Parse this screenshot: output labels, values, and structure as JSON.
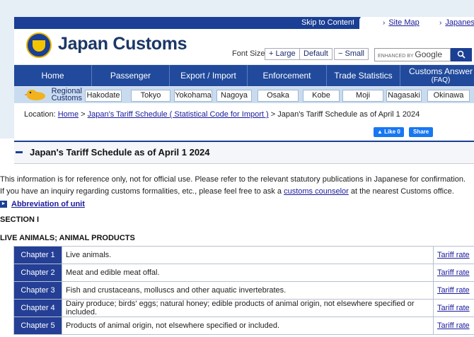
{
  "header": {
    "skip_link": "Skip to Content",
    "top_links": [
      "Site Map",
      "Japanese"
    ],
    "logo_text": "Japan Customs",
    "font_size_label": "Font Size",
    "font_buttons": [
      "+ Large",
      "Default",
      "− Small"
    ],
    "search_enhanced_by": "ENHANCED BY",
    "search_brand": "Google",
    "search_icon": "search-icon"
  },
  "nav": {
    "items": [
      "Home",
      "Passenger",
      "Export / Import",
      "Enforcement",
      "Trade Statistics"
    ],
    "last_item": {
      "line1": "Customs Answer",
      "line2": "(FAQ)"
    }
  },
  "regional": {
    "label_line1": "Regional",
    "label_line2": "Customs",
    "cities": [
      "Hakodate",
      "Tokyo",
      "Yokohama",
      "Nagoya",
      "Osaka",
      "Kobe",
      "Moji",
      "Nagasaki",
      "Okinawa"
    ]
  },
  "breadcrumb": {
    "prefix": "Location:",
    "home": "Home",
    "sep": ">",
    "parent": "Japan's Tariff Schedule ( Statistical Code for Import )",
    "current": "Japan's Tariff Schedule as of April 1 2024"
  },
  "social": {
    "like": "Like 0",
    "share": "Share"
  },
  "page": {
    "title": "Japan's Tariff Schedule as of April 1 2024",
    "notice1": "This information is for reference only, not for official use. Please refer to the relevant statutory publications in Japanese for confirmation.",
    "notice2_before": "If you have an inquiry regarding customs formalities, etc., please feel free to ask a ",
    "notice2_link": "customs counselor",
    "notice2_after": " at the nearest Customs office.",
    "abbreviation_link": "Abbreviation of unit",
    "section": "SECTION I",
    "section_title": "LIVE ANIMALS; ANIMAL PRODUCTS"
  },
  "chapters": [
    {
      "chapter": "Chapter 1",
      "desc": "Live animals.",
      "link": "Tariff rate"
    },
    {
      "chapter": "Chapter 2",
      "desc": "Meat and edible meat offal.",
      "link": "Tariff rate"
    },
    {
      "chapter": "Chapter 3",
      "desc": "Fish and crustaceans, molluscs and other aquatic invertebrates.",
      "link": "Tariff rate"
    },
    {
      "chapter": "Chapter 4",
      "desc": "Dairy produce; birds' eggs; natural honey; edible products of animal origin, not elsewhere specified or included.",
      "link": "Tariff rate"
    },
    {
      "chapter": "Chapter 5",
      "desc": "Products of animal origin, not elsewhere specified or included.",
      "link": "Tariff rate"
    }
  ]
}
